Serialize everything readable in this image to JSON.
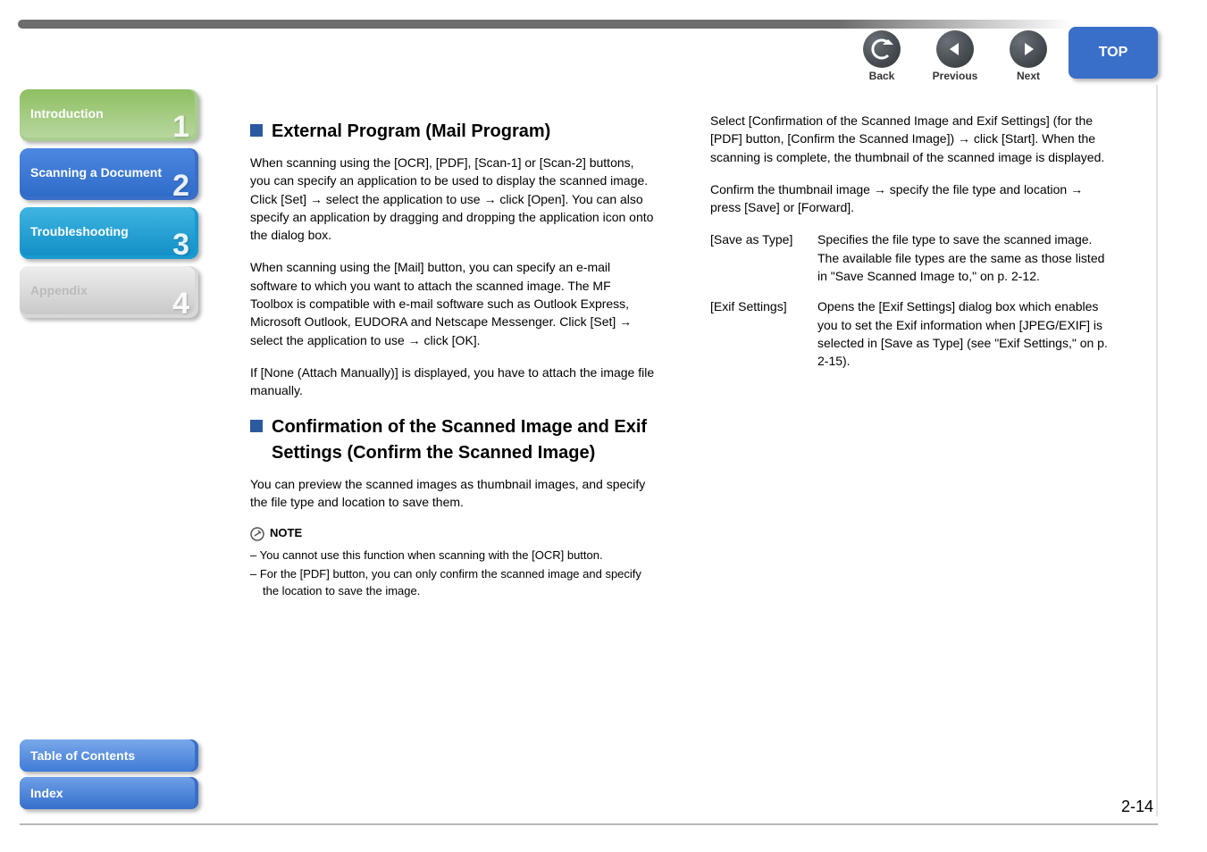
{
  "nav": {
    "back": {
      "label": "Back"
    },
    "prev": {
      "label": "Previous"
    },
    "next": {
      "label": "Next"
    },
    "top": {
      "label": "TOP"
    }
  },
  "sidebar": {
    "items": [
      {
        "label": "Introduction",
        "num": "1"
      },
      {
        "label": "Scanning a Document",
        "num": "2"
      },
      {
        "label": "Troubleshooting",
        "num": "3"
      },
      {
        "label": "Appendix",
        "num": "4"
      }
    ],
    "toc": {
      "label": "Table of Contents"
    },
    "index": {
      "label": "Index"
    }
  },
  "left": {
    "h1": "External Program (Mail Program)",
    "p1": "When scanning using the [OCR], [PDF], [Scan-1] or [Scan-2] buttons, you can specify an application to be used to display the scanned image. Click [Set] → select the application to use → click [Open]. You can also specify an application by dragging and dropping the application icon onto the dialog box.",
    "p2": "When scanning using the [Mail] button, you can specify an e-mail software to which you want to attach the scanned image. The MF Toolbox is compatible with e-mail software such as Outlook Express, Microsoft Outlook, EUDORA and Netscape Messenger. Click [Set] → select the application to use → click [OK].",
    "p3": "If [None (Attach Manually)] is displayed, you have to attach the image file manually.",
    "h2": "Confirmation of the Scanned Image and Exif Settings (Confirm the Scanned Image)",
    "p4": "You can preview the scanned images as thumbnail images, and specify the file type and location to save them.",
    "note_label": "NOTE",
    "note1": "– You cannot use this function when scanning with the [OCR] button.",
    "note2": "– For the [PDF] button, you can only confirm the scanned image and specify the location to save the image."
  },
  "right": {
    "p1": "Select [Confirmation of the Scanned Image and Exif Settings] (for the [PDF] button, [Confirm the Scanned Image]) → click [Start]. When the scanning is complete, the thumbnail of the scanned image is displayed.",
    "p2": "Confirm the thumbnail image → specify the file type and location → press [Save] or [Forward].",
    "rows": [
      {
        "term": "[Save as Type]",
        "def": "Specifies the file type to save the scanned image. The available file types are the same as those listed in \"Save Scanned Image to,\" on p. 2-12."
      },
      {
        "term": "[Exif Settings]",
        "def": "Opens the [Exif Settings] dialog box which enables you to set the Exif information when [JPEG/EXIF] is selected in [Save as Type] (see \"Exif Settings,\" on p. 2-15)."
      }
    ]
  },
  "page_number": "2-14"
}
